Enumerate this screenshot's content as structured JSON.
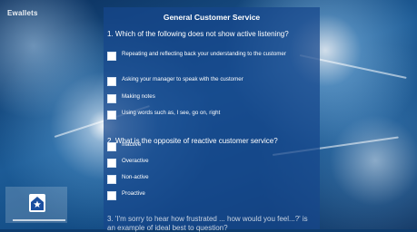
{
  "app": {
    "logo_text": "Ewallets",
    "title": "General Customer Service"
  },
  "questions": [
    {
      "text": "1. Which of the following does not show active listening?",
      "options": [
        "Repeating and reflecting back your understanding to the customer",
        "Asking your manager to speak with the customer",
        "Making notes",
        "Using words such as, I see, go on, right"
      ]
    },
    {
      "text": "2. What is the opposite of reactive customer service?",
      "options": [
        "Inactive",
        "Overactive",
        "Non-active",
        "Proactive"
      ]
    },
    {
      "text": "3. 'I'm sorry to hear how frustrated ... how would you feel...?' is an example of ideal best to question?",
      "options": []
    }
  ],
  "colors": {
    "panel": "#16468c",
    "accent": "#1b4fa0",
    "text": "#ffffff"
  },
  "icons": {
    "home": "home-star-icon"
  }
}
